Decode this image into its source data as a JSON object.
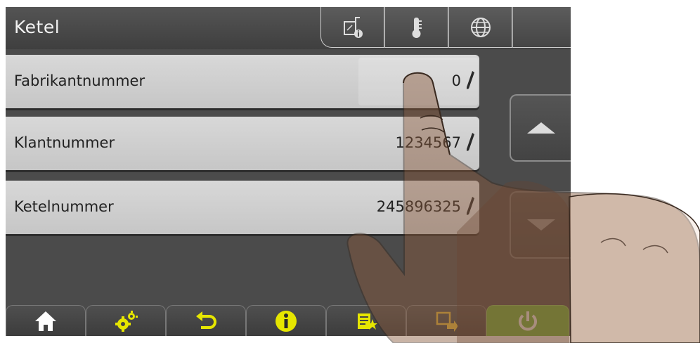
{
  "header": {
    "title": "Ketel",
    "tabs": [
      {
        "icon": "boiler-info-icon"
      },
      {
        "icon": "thermometer-icon"
      },
      {
        "icon": "globe-icon"
      },
      {
        "icon": "empty-tab"
      }
    ]
  },
  "rows": [
    {
      "label": "Fabrikantnummer",
      "value": "0"
    },
    {
      "label": "Klantnummer",
      "value": "1234567"
    },
    {
      "label": "Ketelnummer",
      "value": "245896325"
    }
  ],
  "bottom_bar": {
    "buttons": [
      {
        "icon": "home-icon"
      },
      {
        "icon": "settings-gears-icon"
      },
      {
        "icon": "back-arrow-icon"
      },
      {
        "icon": "info-icon"
      },
      {
        "icon": "favorites-list-icon"
      },
      {
        "icon": "screen-transfer-icon"
      },
      {
        "icon": "power-icon"
      }
    ]
  },
  "colors": {
    "accent_yellow": "#e6e600",
    "power_green": "#6dbd3a",
    "background": "#4b4b4b",
    "row": "#cfcfcf"
  }
}
